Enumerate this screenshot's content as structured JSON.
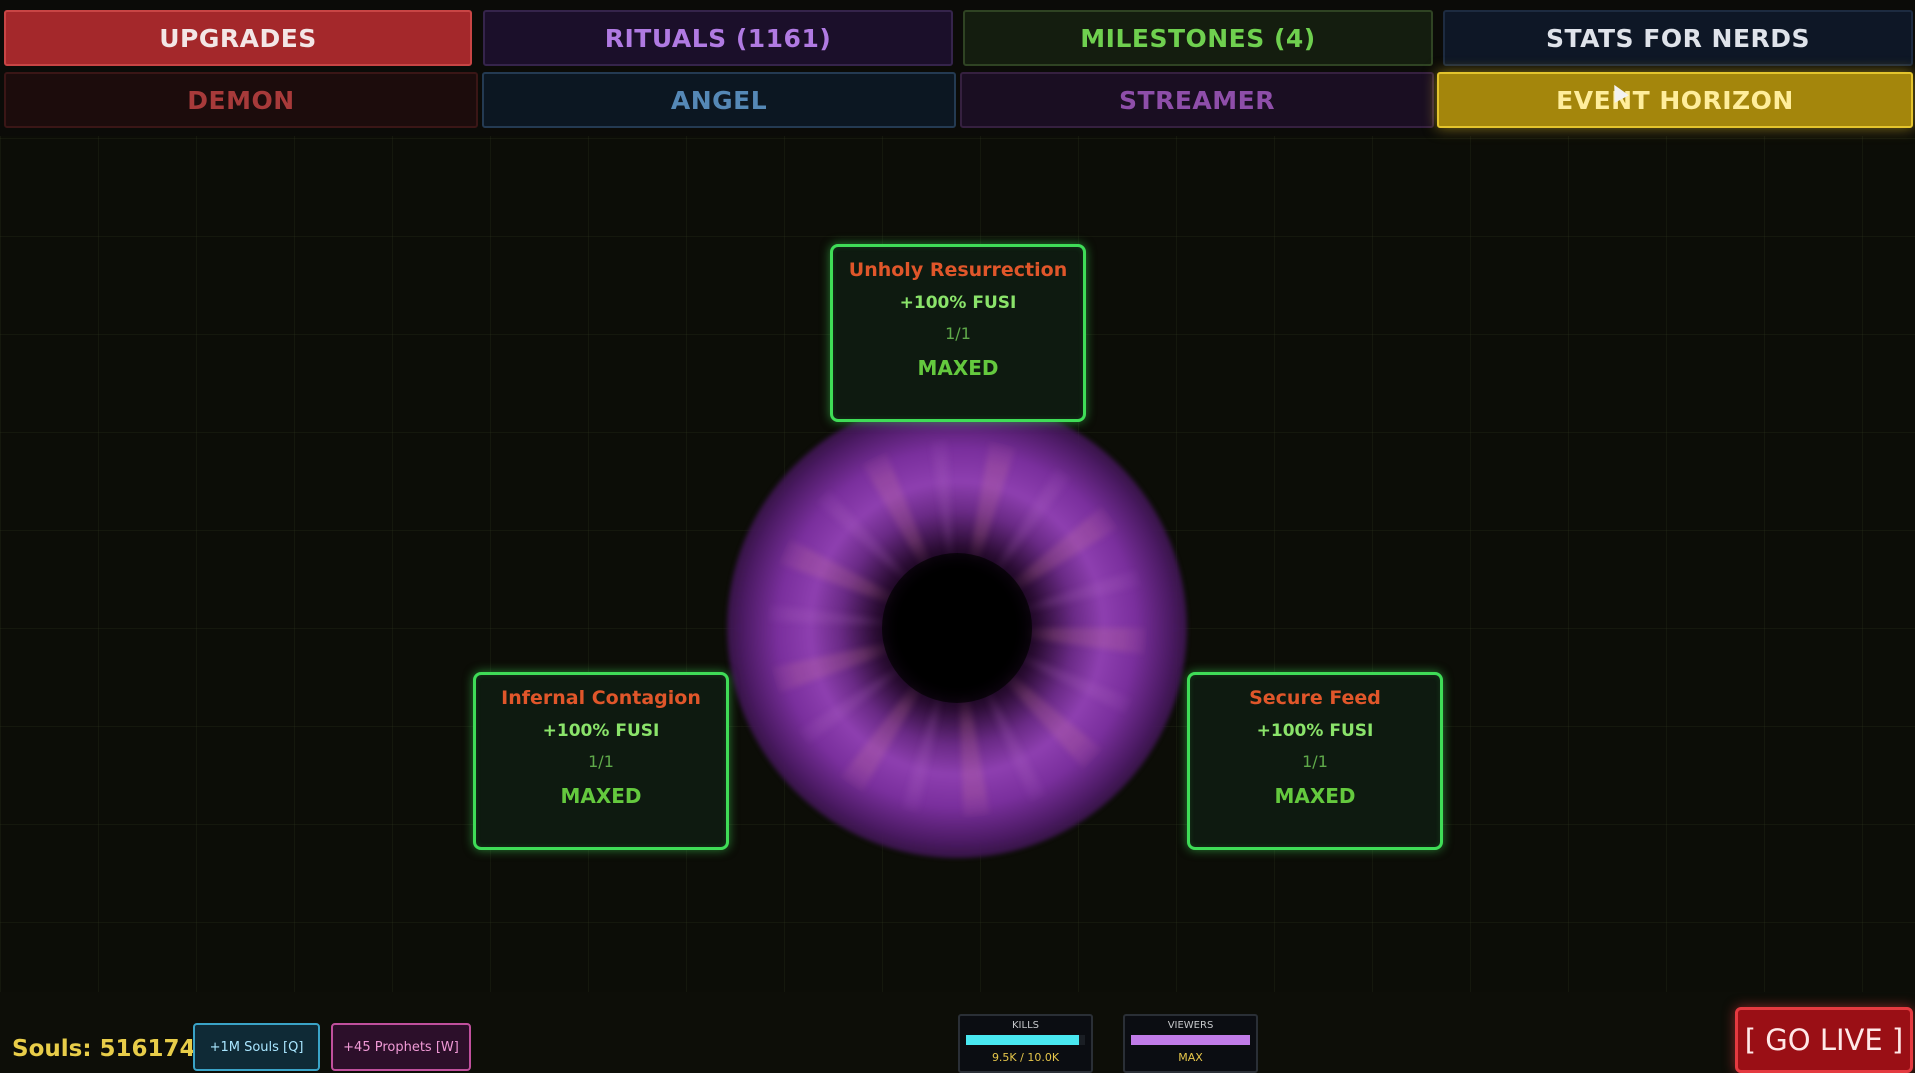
{
  "tabs_row1": [
    {
      "label": "UPGRADES"
    },
    {
      "label": "RITUALS (1161)"
    },
    {
      "label": "MILESTONES (4)"
    },
    {
      "label": "STATS FOR NERDS"
    }
  ],
  "tabs_row2": [
    {
      "label": "DEMON"
    },
    {
      "label": "ANGEL"
    },
    {
      "label": "STREAMER"
    },
    {
      "label": "EVENT HORIZON",
      "active": true
    }
  ],
  "upgrades": [
    {
      "title": "Unholy Resurrection",
      "effect": "+100% FUSI",
      "level": "1/1",
      "status": "MAXED"
    },
    {
      "title": "Infernal Contagion",
      "effect": "+100% FUSI",
      "level": "1/1",
      "status": "MAXED"
    },
    {
      "title": "Secure Feed",
      "effect": "+100% FUSI",
      "level": "1/1",
      "status": "MAXED"
    }
  ],
  "bottom": {
    "souls": "Souls: 5161749",
    "souls_button": "+1M Souls [Q]",
    "prophets_button": "+45 Prophets [W]",
    "kills": {
      "label": "KILLS",
      "value": "9.5K / 10.0K",
      "fraction": 0.95
    },
    "viewers": {
      "label": "VIEWERS",
      "value": "MAX",
      "fraction": 1.0
    },
    "go_live": "[ GO LIVE ]"
  },
  "colors": {
    "accent_event_horizon": "#e4c42d",
    "maxed_border": "#3fdc57",
    "go_live": "#9a0f15"
  },
  "icons": [
    "black-hole-visual",
    "mouse-cursor-icon"
  ]
}
